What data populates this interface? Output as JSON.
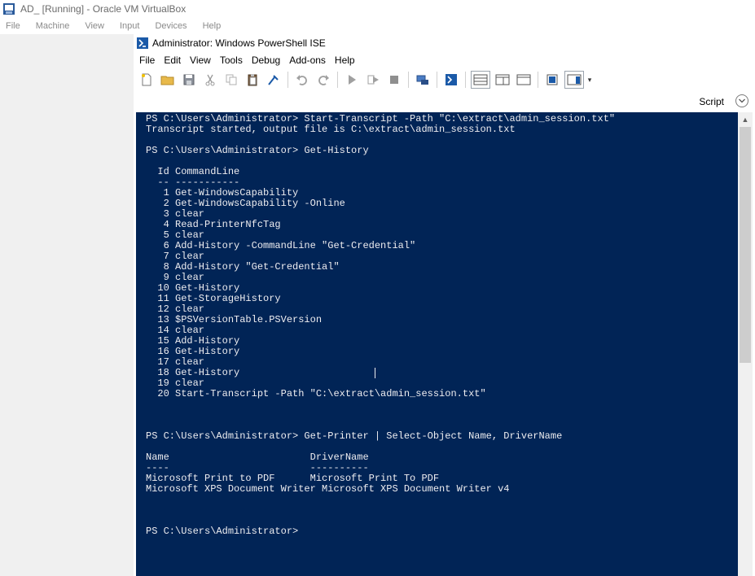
{
  "host": {
    "title": "AD_ [Running] - Oracle VM VirtualBox",
    "menu": [
      "File",
      "Machine",
      "View",
      "Input",
      "Devices",
      "Help"
    ]
  },
  "ise": {
    "title": "Administrator: Windows PowerShell ISE",
    "menu": [
      "File",
      "Edit",
      "View",
      "Tools",
      "Debug",
      "Add-ons",
      "Help"
    ],
    "toolbar": [
      {
        "icon": "new-file-icon"
      },
      {
        "icon": "open-folder-icon"
      },
      {
        "icon": "save-icon"
      },
      {
        "icon": "cut-icon"
      },
      {
        "icon": "copy-icon"
      },
      {
        "icon": "paste-icon"
      },
      {
        "icon": "clear-console-icon"
      },
      {
        "icon": "undo-icon"
      },
      {
        "icon": "redo-icon"
      },
      {
        "icon": "run-script-icon"
      },
      {
        "icon": "run-selection-icon"
      },
      {
        "icon": "stop-icon"
      },
      {
        "icon": "new-remote-tab-icon"
      },
      {
        "icon": "powershell-console-icon"
      },
      {
        "icon": "layout-top-icon"
      },
      {
        "icon": "layout-right-icon"
      },
      {
        "icon": "layout-max-icon"
      },
      {
        "icon": "show-command-window-icon"
      },
      {
        "icon": "show-command-addon-icon"
      }
    ],
    "script_label": "Script",
    "accent": "#1b5aa8",
    "console_background": "#012456",
    "console_foreground": "#eeedf0"
  },
  "console": {
    "lines": [
      "PS C:\\Users\\Administrator> Start-Transcript -Path \"C:\\extract\\admin_session.txt\"",
      "Transcript started, output file is C:\\extract\\admin_session.txt",
      "",
      "PS C:\\Users\\Administrator> Get-History",
      "",
      "  Id CommandLine",
      "  -- -----------",
      "   1 Get-WindowsCapability",
      "   2 Get-WindowsCapability -Online",
      "   3 clear",
      "   4 Read-PrinterNfcTag",
      "   5 clear",
      "   6 Add-History -CommandLine \"Get-Credential\"",
      "   7 clear",
      "   8 Add-History \"Get-Credential\"",
      "   9 clear",
      "  10 Get-History",
      "  11 Get-StorageHistory",
      "  12 clear",
      "  13 $PSVersionTable.PSVersion",
      "  14 clear",
      "  15 Add-History",
      "  16 Get-History",
      "  17 clear",
      "  18 Get-History",
      "  19 clear",
      "  20 Start-Transcript -Path \"C:\\extract\\admin_session.txt\"",
      "",
      "",
      "",
      "PS C:\\Users\\Administrator> Get-Printer | Select-Object Name, DriverName",
      "",
      "Name                        DriverName",
      "----                        ----------",
      "Microsoft Print to PDF      Microsoft Print To PDF",
      "Microsoft XPS Document Writer Microsoft XPS Document Writer v4",
      "",
      "",
      "",
      "PS C:\\Users\\Administrator>"
    ]
  }
}
